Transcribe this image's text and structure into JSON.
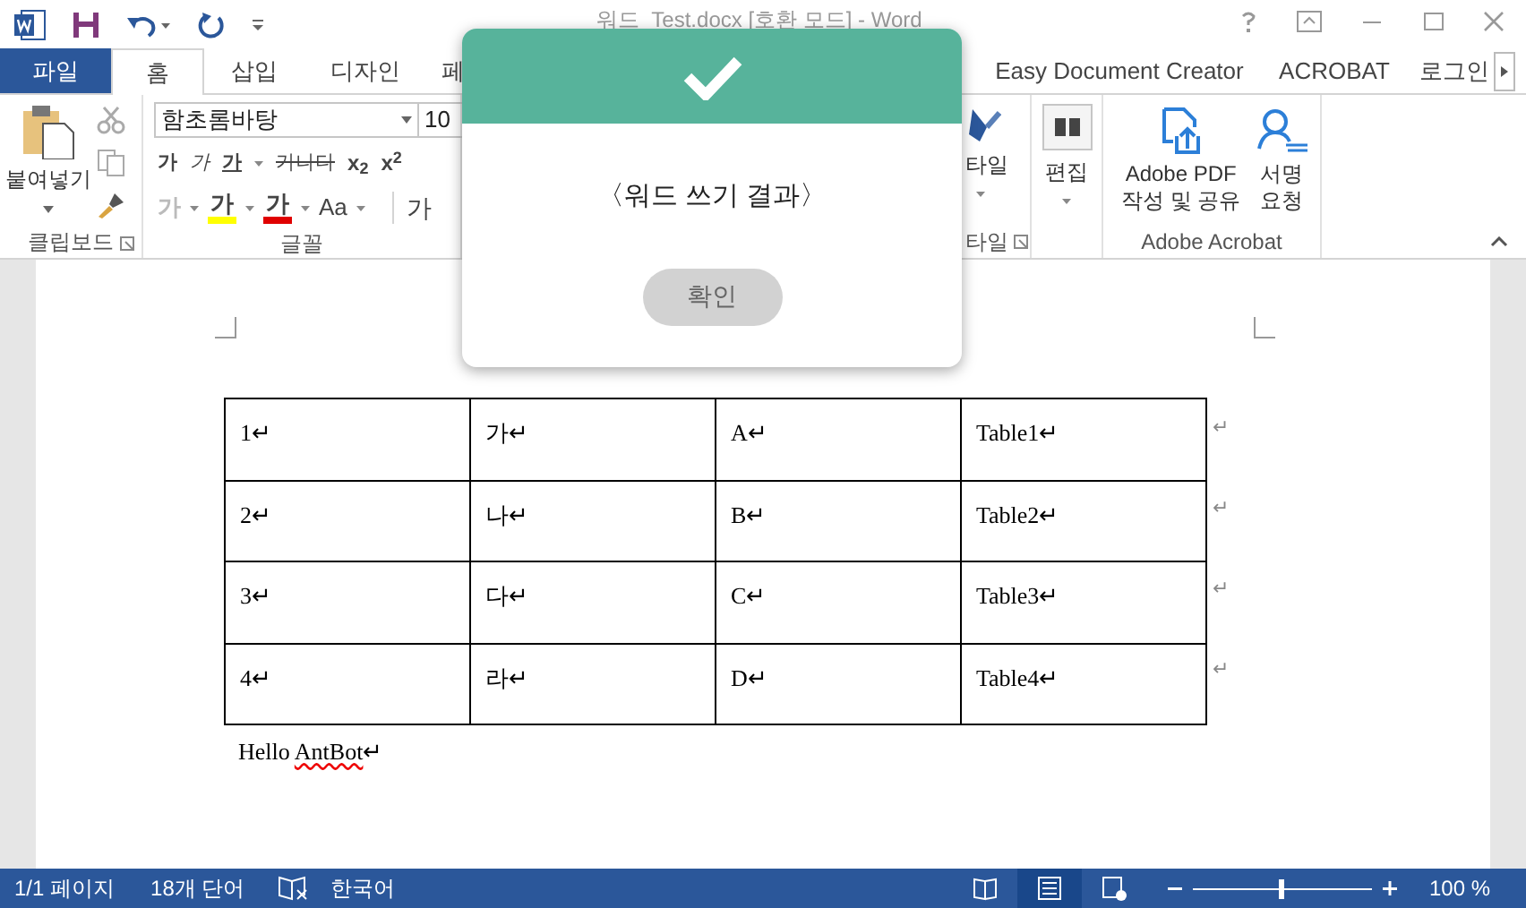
{
  "window": {
    "title": "워드_Test.docx [호환 모드] - Word"
  },
  "ribbon_tabs": [
    {
      "label": "파일",
      "kind": "file",
      "selected": false
    },
    {
      "label": "홈",
      "kind": "tab",
      "selected": true
    },
    {
      "label": "삽입",
      "kind": "tab",
      "selected": false
    },
    {
      "label": "디자인",
      "kind": "tab",
      "selected": false
    },
    {
      "label": "페",
      "kind": "tab",
      "selected": false
    },
    {
      "label": "Easy Document Creator",
      "kind": "tab",
      "selected": false
    },
    {
      "label": "ACROBAT",
      "kind": "tab",
      "selected": false
    },
    {
      "label": "로그인",
      "kind": "account",
      "selected": false
    }
  ],
  "clipboard": {
    "paste": "붙여넣기",
    "group_label": "클립보드"
  },
  "font": {
    "font_name": "함초롬바탕",
    "font_size": "10",
    "group_label": "글꼴",
    "row1": [
      {
        "text": "가",
        "kind": "bold"
      },
      {
        "text": "가",
        "kind": "italic"
      },
      {
        "text": "가",
        "kind": "underline"
      },
      {
        "text": "가나다",
        "kind": "strike"
      },
      {
        "text": "x$_{2}$",
        "kind": "script"
      },
      {
        "text": "x$^{2}$",
        "kind": "script"
      }
    ],
    "row2": [
      {
        "text": "가",
        "kind": "effect"
      },
      {
        "text": "가",
        "kind": "highlight",
        "color": "#ffff00"
      },
      {
        "text": "가",
        "kind": "fontcolor",
        "color": "#e00000"
      },
      {
        "text": "Aa",
        "kind": "case"
      }
    ],
    "grow": "가"
  },
  "styles": {
    "label": "타일",
    "group_label": "타일"
  },
  "editing": {
    "label": "편집"
  },
  "acrobat": {
    "buttons": [
      "Adobe PDF\n작성 및 공유",
      "서명\n요청"
    ],
    "group_label": "Adobe Acrobat"
  },
  "dialog": {
    "message": "〈워드 쓰기 결과〉",
    "button": "확인"
  },
  "table": {
    "rows": [
      [
        "1↵",
        "가↵",
        "A↵",
        "Table1↵"
      ],
      [
        "2↵",
        "나↵",
        "B↵",
        "Table2↵"
      ],
      [
        "3↵",
        "다↵",
        "C↵",
        "Table3↵"
      ],
      [
        "4↵",
        "라↵",
        "D↵",
        "Table4↵"
      ]
    ],
    "row_end": "↵"
  },
  "paragraph": {
    "text": "Hello ",
    "misspelled": "AntBot",
    "mark": "↵"
  },
  "status_bar": {
    "page": "1/1 페이지",
    "words": "18개 단어",
    "language": "한국어",
    "views": [
      {
        "kind": "read",
        "selected": false
      },
      {
        "kind": "print",
        "selected": true
      },
      {
        "kind": "web",
        "selected": false
      }
    ],
    "zoom": {
      "level": 0.5,
      "reading": "100 %"
    }
  }
}
